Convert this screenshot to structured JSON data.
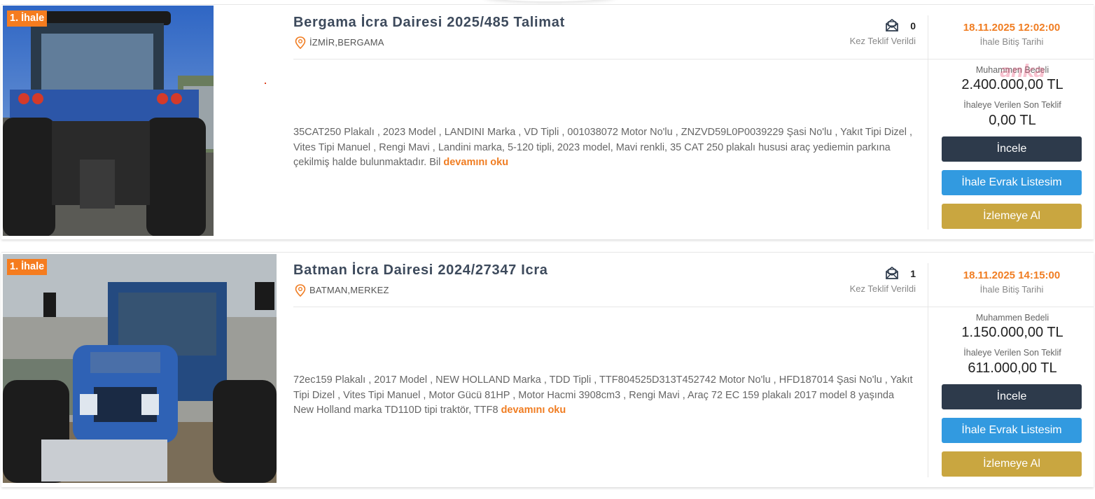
{
  "listings": [
    {
      "badge": "1. İhale",
      "title": "Bergama İcra Dairesi 2025/485 Talimat",
      "location": "İZMİR,BERGAMA",
      "bid_count": "0",
      "bid_label": "Kez Teklif Verildi",
      "end_date": "18.11.2025 12:02:00",
      "end_date_label": "İhale Bitiş Tarihi",
      "estimated_label": "Muhammen Bedeli",
      "estimated_value": "2.400.000,00 TL",
      "last_bid_label": "İhaleye Verilen Son Teklif",
      "last_bid_value": "0,00 TL",
      "description": "35CAT250 Plakalı , 2023 Model , LANDINI Marka , VD Tipli , 001038072 Motor No'lu , ZNZVD59L0P0039229 Şasi No'lu , Yakıt Tipi Dizel , Vites Tipi Manuel , Rengi Mavi , Landini marka, 5-120 tipli, 2023 model, Mavi renkli, 35 CAT 250 plakalı hususi araç yediemin parkına çekilmiş halde bulunmaktadır. Bil",
      "read_more": "devamını oku",
      "buttons": {
        "inspect": "İncele",
        "documents": "İhale Evrak Listesim",
        "watch": "İzlemeye Al"
      },
      "watermark": "anka"
    },
    {
      "badge": "1. İhale",
      "title": "Batman İcra Dairesi 2024/27347 Icra",
      "location": "BATMAN,MERKEZ",
      "bid_count": "1",
      "bid_label": "Kez Teklif Verildi",
      "end_date": "18.11.2025 14:15:00",
      "end_date_label": "İhale Bitiş Tarihi",
      "estimated_label": "Muhammen Bedeli",
      "estimated_value": "1.150.000,00 TL",
      "last_bid_label": "İhaleye Verilen Son Teklif",
      "last_bid_value": "611.000,00 TL",
      "description": "72ec159 Plakalı , 2017 Model , NEW HOLLAND Marka , TDD Tipli , TTF804525D313T452742 Motor No'lu , HFD187014 Şasi No'lu , Yakıt Tipi Dizel , Vites Tipi Manuel , Motor Gücü 81HP , Motor Hacmi 3908cm3 , Rengi Mavi , Araç 72 EC 159 plakalı 2017 model 8 yaşında New Holland marka TD110D tipi traktör, TTF8",
      "read_more": "devamını oku",
      "buttons": {
        "inspect": "İncele",
        "documents": "İhale Evrak Listesim",
        "watch": "İzlemeye Al"
      }
    }
  ],
  "colors": {
    "accent_orange": "#f07d22",
    "title": "#3d4a5c",
    "btn_dark": "#2d3a4b",
    "btn_blue": "#329ae0",
    "btn_gold": "#c9a640"
  },
  "icons": {
    "location": "map-pin-icon",
    "bids": "open-envelope-icon"
  }
}
